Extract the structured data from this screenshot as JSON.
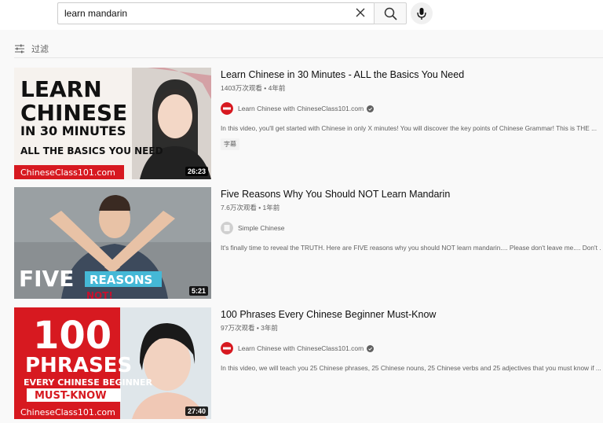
{
  "search": {
    "query": "learn mandarin"
  },
  "filter": {
    "label": "过滤"
  },
  "results": [
    {
      "title": "Learn Chinese in 30 Minutes - ALL the Basics You Need",
      "views": "1403万次观看",
      "age": "4年前",
      "channel": "Learn Chinese with ChineseClass101.com",
      "verified": true,
      "description": "In this video, you'll get started with Chinese in only X minutes! You will discover the key points of Chinese Grammar! This is THE ...",
      "badge": "字幕",
      "duration": "26:23",
      "thumb_text": {
        "line1": "LEARN",
        "line2": "CHINESE",
        "line3": "IN 30 MINUTES",
        "line4": "ALL THE BASICS YOU NEED",
        "footer": "ChineseClass101.com"
      }
    },
    {
      "title": "Five Reasons Why You Should NOT Learn Mandarin",
      "views": "7.6万次观看",
      "age": "1年前",
      "channel": "Simple Chinese",
      "verified": false,
      "description": "It's finally time to reveal the TRUTH. Here are FIVE reasons why you should NOT learn mandarin.... Please don't leave me.... Don't ...",
      "duration": "5:21",
      "thumb_text": {
        "line1": "FIVE",
        "line2": "REASONS",
        "line3": "NOT!"
      }
    },
    {
      "title": "100 Phrases Every Chinese Beginner Must-Know",
      "views": "97万次观看",
      "age": "3年前",
      "channel": "Learn Chinese with ChineseClass101.com",
      "verified": true,
      "description": "In this video, we will teach you 25 Chinese phrases, 25 Chinese nouns, 25 Chinese verbs and 25 adjectives that you must know if ...",
      "duration": "27:40",
      "thumb_text": {
        "line1": "100",
        "line2": "PHRASES",
        "line3": "EVERY CHINESE BEGINNER",
        "line4": "MUST-KNOW",
        "footer": "ChineseClass101.com"
      }
    }
  ]
}
